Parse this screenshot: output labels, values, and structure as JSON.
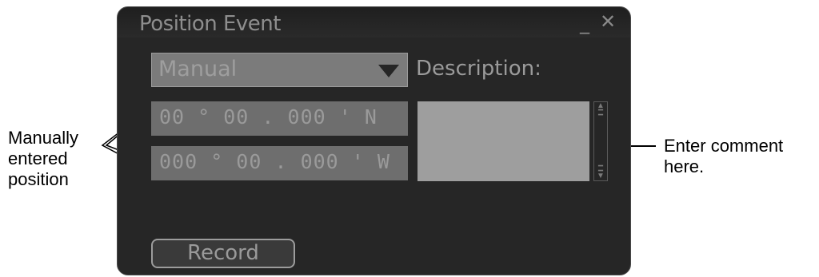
{
  "dialog": {
    "title": "Position Event",
    "minimize_glyph": "_",
    "close_glyph": "✕",
    "mode_select": {
      "value": "Manual"
    },
    "description_label": "Description:",
    "latitude": "00 ° 00 . 000 ' N",
    "longitude": "000 ° 00 . 000 ' W",
    "comment": "",
    "record_label": "Record"
  },
  "annotations": {
    "left": [
      "Manually",
      "entered",
      "position"
    ],
    "right": [
      "Enter comment",
      "here."
    ]
  },
  "icons": [
    "minimize-icon",
    "close-icon",
    "dropdown-arrow-icon",
    "scroll-up-icon",
    "scroll-down-icon"
  ]
}
